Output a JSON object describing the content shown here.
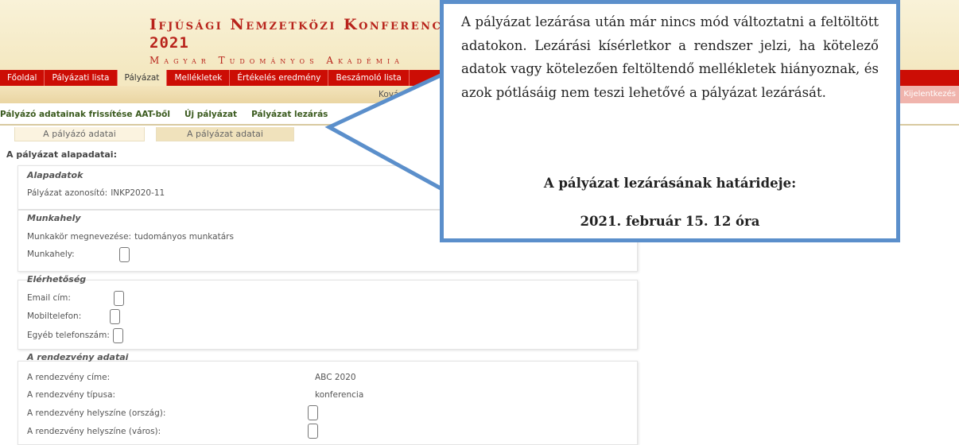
{
  "header": {
    "title": "Ifjúsági Nemzetközi Konferencia",
    "year": "2021",
    "subtitle": "Magyar Tudományos Akadémia"
  },
  "nav": {
    "items": [
      "Főoldal",
      "Pályázati lista",
      "Pályázat",
      "Mellékletek",
      "Értékelés eredmény",
      "Beszámoló lista"
    ],
    "active_index": 2
  },
  "userbar": {
    "user": "Kovács János",
    "logout": "Kijelentkezés"
  },
  "subnav": {
    "items": [
      "Pályázó adatainak frissítése AAT-ből",
      "Új pályázat",
      "Pályázat lezárás"
    ]
  },
  "tabs": [
    "A pályázó adatai",
    "A pályázat adatai"
  ],
  "section_title": "A pályázat alapadatai:",
  "groups": {
    "alapadatok": {
      "heading": "Alapadatok",
      "azonosito_label": "Pályázat azonosító:",
      "azonosito_value": "INKP2020-11"
    },
    "munkahely": {
      "heading": "Munkahely",
      "munkakor_label": "Munkakör megnevezése:",
      "munkakor_value": "tudományos munkatárs",
      "munkahely_label": "Munkahely:"
    },
    "elerhetoseg": {
      "heading": "Elérhetőség",
      "email_label": "Email cím:",
      "mobil_label": "Mobiltelefon:",
      "egyeb_label": "Egyéb telefonszám:"
    },
    "rendezveny": {
      "heading": "A rendezvény adatai",
      "cim_label": "A rendezvény címe:",
      "cim_value": "ABC 2020",
      "tipus_label": "A rendezvény típusa:",
      "tipus_value": "konferencia",
      "orszag_label": "A rendezvény helyszíne (ország):",
      "varos_label": "A rendezvény helyszíne (város):"
    }
  },
  "callout": {
    "text": "A pályázat lezárása után már nincs mód változtatni a feltöltött adatokon. Lezárási kísérletkor a rendszer jelzi, ha kötelező adatok vagy kötelezően feltöltendő mellékletek hiányoznak, és azok pótlásáig nem teszi lehetővé a pályázat lezárását.",
    "deadline_label": "A pályázat lezárásának határideje:",
    "deadline_value": "2021. február 15. 12 óra",
    "border_color": "#5b8fcb"
  },
  "colors": {
    "nav_red": "#cc0d05",
    "title_red": "#b8231b",
    "cream": "#f4e8c1"
  }
}
